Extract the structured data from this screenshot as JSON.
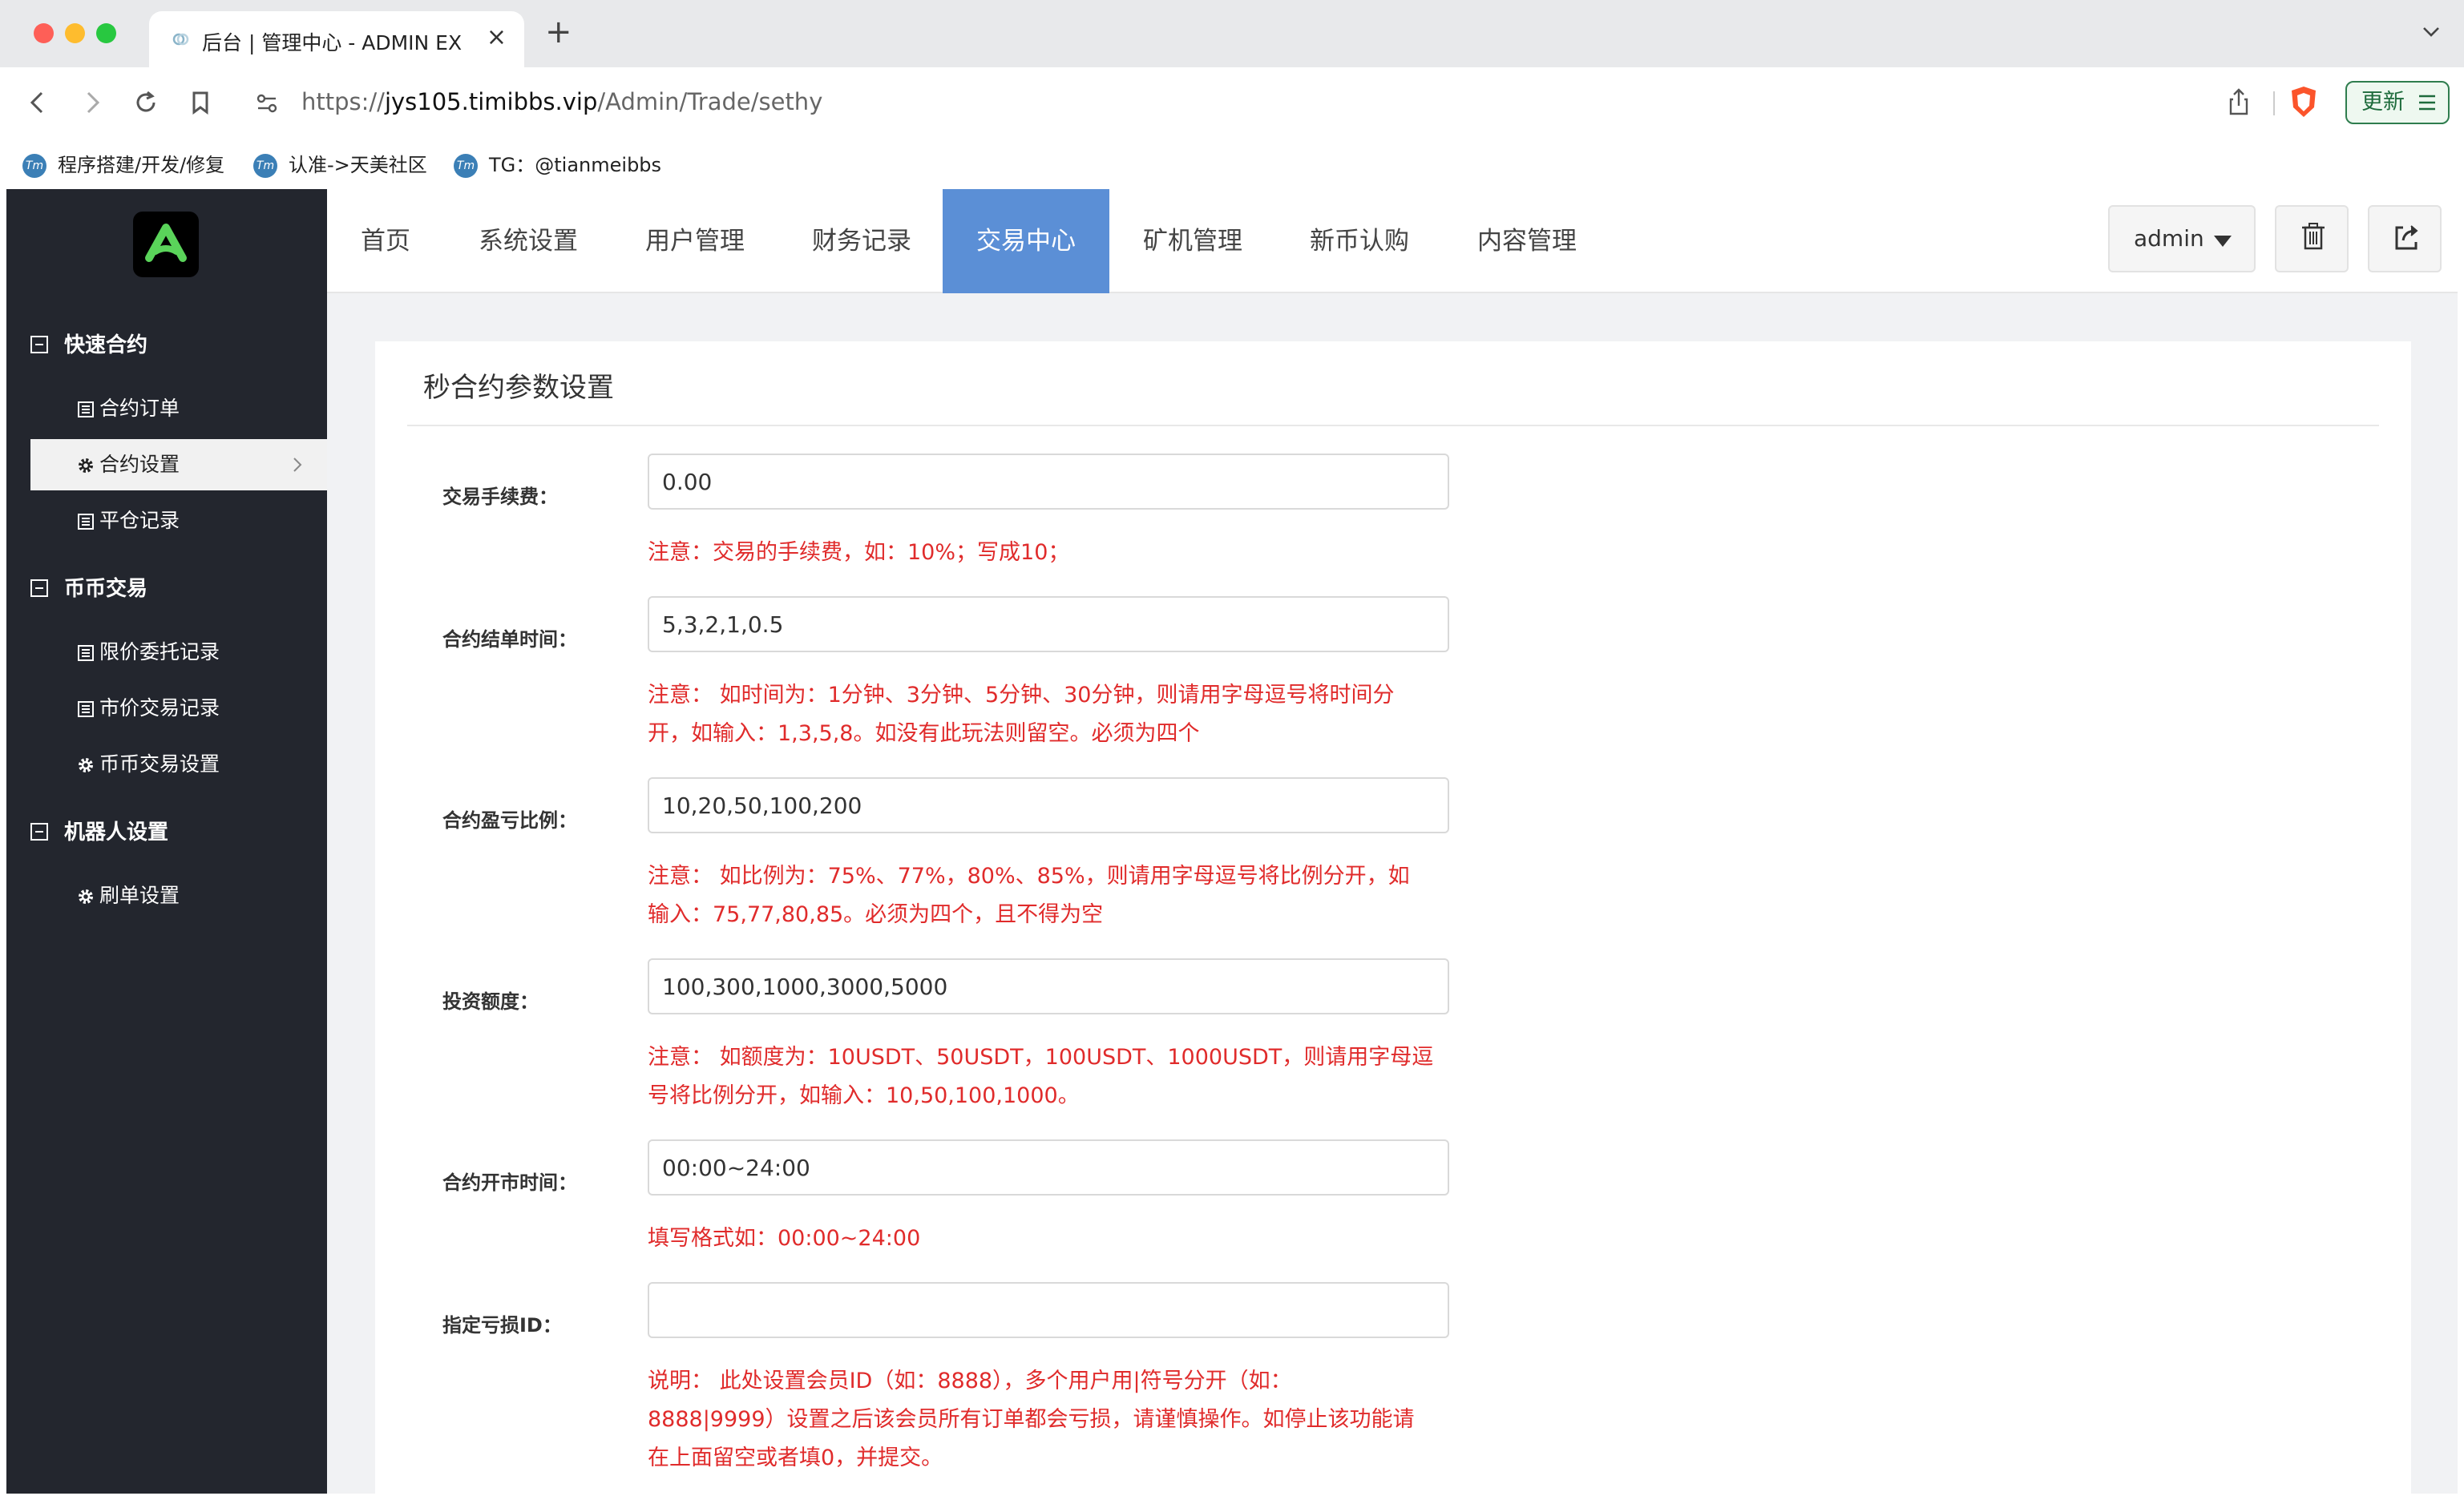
{
  "browser": {
    "tab_title": "后台 | 管理中心 - ADMIN EX",
    "url_scheme": "https://",
    "url_host": "jys105.timibbs.vip",
    "url_path": "/Admin/Trade/sethy",
    "update_label": "更新",
    "bookmarks": [
      {
        "label": "程序搭建/开发/修复",
        "icon": "tm-logo-icon"
      },
      {
        "label": "认准->天美社区",
        "icon": "tm-logo-icon"
      },
      {
        "label": "TG：@tianmeibbs",
        "icon": "tm-logo-icon"
      }
    ],
    "tm_icon_text": "Tm"
  },
  "sidebar": {
    "groups": [
      {
        "label": "快速合约",
        "items": [
          "合约订单",
          "合约设置",
          "平仓记录"
        ]
      },
      {
        "label": "币币交易",
        "items": [
          "限价委托记录",
          "市价交易记录",
          "币币交易设置"
        ]
      },
      {
        "label": "机器人设置",
        "items": [
          "刷单设置"
        ]
      }
    ],
    "active_item": "合约设置",
    "colors": {
      "bg": "#23262e",
      "active_bg": "#f1f1f1",
      "logo_green": "#5ad45a"
    }
  },
  "topnav": {
    "items": [
      "首页",
      "系统设置",
      "用户管理",
      "财务记录",
      "交易中心",
      "矿机管理",
      "新币认购",
      "内容管理"
    ],
    "active": "交易中心",
    "user": "admin",
    "accent": "#5b8fd6"
  },
  "form": {
    "title": "秒合约参数设置",
    "fields": [
      {
        "label": "交易手续费：",
        "value": "0.00",
        "note": "注意：交易的手续费，如：10%；写成10；"
      },
      {
        "label": "合约结单时间：",
        "value": "5,3,2,1,0.5",
        "note_lines": [
          "注意： 如时间为：1分钟、3分钟、5分钟、30分钟，则请用字母逗号将时间分",
          "开，如输入：1,3,5,8。如没有此玩法则留空。必须为四个"
        ]
      },
      {
        "label": "合约盈亏比例：",
        "value": "10,20,50,100,200",
        "note_lines": [
          "注意： 如比例为：75%、77%，80%、85%，则请用字母逗号将比例分开，如",
          "输入：75,77,80,85。必须为四个，且不得为空"
        ]
      },
      {
        "label": "投资额度：",
        "value": "100,300,1000,3000,5000",
        "note_lines": [
          "注意： 如额度为：10USDT、50USDT，100USDT、1000USDT，则请用字母逗",
          "号将比例分开，如输入：10,50,100,1000。"
        ]
      },
      {
        "label": "合约开市时间：",
        "value": "00:00~24:00",
        "note": "填写格式如：00:00~24:00"
      },
      {
        "label": "指定亏损ID：",
        "value": "",
        "note_lines": [
          "说明： 此处设置会员ID（如：8888），多个用户用|符号分开（如：",
          "8888|9999）设置之后该会员所有订单都会亏损，请谨慎操作。如停止该功能请",
          "在上面留空或者填0，并提交。"
        ]
      }
    ],
    "note_color": "#e02b2b"
  }
}
